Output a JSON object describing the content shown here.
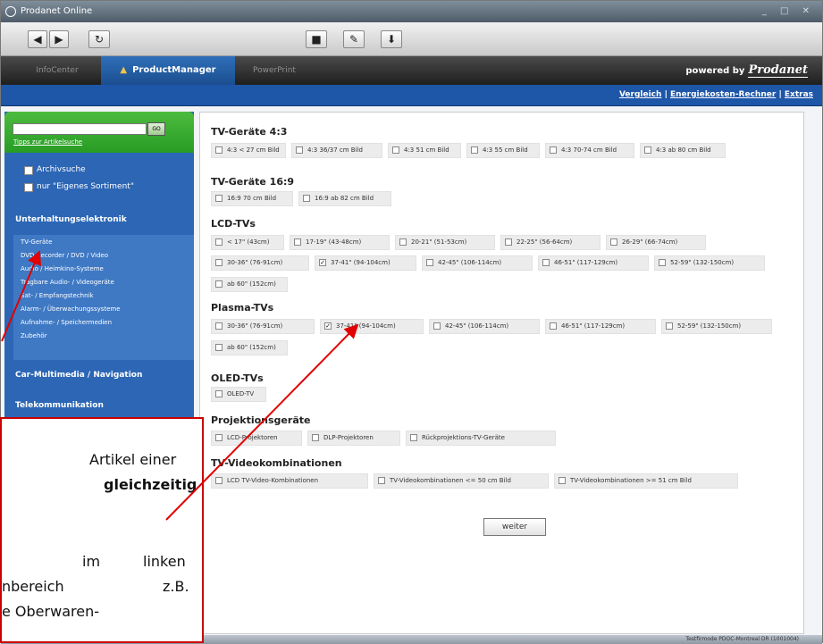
{
  "window": {
    "title": "Prodanet Online"
  },
  "toolbar": {
    "back": "◀",
    "forward": "▶",
    "refresh": "↻",
    "btn1": "■",
    "btn2": "✎",
    "btn3": "⬇"
  },
  "tabs": [
    {
      "label": "InfoCenter",
      "active": false
    },
    {
      "label": "ProductManager",
      "active": true
    },
    {
      "label": "PowerPrint",
      "active": false
    }
  ],
  "header": {
    "powered_by": "powered by",
    "brand": "Prodanet"
  },
  "toplinks": {
    "vergleich": "Vergleich",
    "sep": "|",
    "rechner": "Energiekosten-Rechner",
    "extras": "Extras"
  },
  "sidebar": {
    "search_button": "GO",
    "tipps": "Tipps zur Artikelsuche",
    "checkbox1": "Archivsuche",
    "checkbox2": "nur \"Eigenes Sortiment\"",
    "category1": "Unterhaltungselektronik",
    "subitems": [
      "TV-Geräte",
      "DVD-Recorder / DVD / Video",
      "Audio / Heimkino-Systeme",
      "Tragbare Audio- / Videogeräte",
      "Sat- / Empfangstechnik",
      "Alarm- / Überwachungssysteme",
      "Aufnahme- / Speichermedien",
      "Zubehör"
    ],
    "category2": "Car-Multimedia / Navigation",
    "category3": "Telekommunikation"
  },
  "groups": {
    "g1": {
      "title": "TV-Geräte 4:3",
      "options": [
        "4:3 < 27 cm Bild",
        "4:3 36/37 cm Bild",
        "4:3 51 cm Bild",
        "4:3 55 cm Bild",
        "4:3 70-74 cm Bild",
        "4:3 ab 80 cm Bild"
      ]
    },
    "g2": {
      "title": "TV-Geräte 16:9",
      "options": [
        "16:9 70 cm Bild",
        "16:9 ab 82 cm Bild"
      ]
    },
    "g3": {
      "title": "LCD-TVs",
      "options": [
        "< 17\" (43cm)",
        "17-19\" (43-48cm)",
        "20-21\" (51-53cm)",
        "22-25\" (56-64cm)",
        "26-29\" (66-74cm)",
        "30-36\" (76-91cm)",
        "37-41\" (94-104cm)",
        "42-45\" (106-114cm)",
        "46-51\" (117-129cm)",
        "52-59\" (132-150cm)",
        "ab 60\" (152cm)"
      ]
    },
    "g4": {
      "title": "Plasma-TVs",
      "options": [
        "30-36\" (76-91cm)",
        "37-41\" (94-104cm)",
        "42-45\" (106-114cm)",
        "46-51\" (117-129cm)",
        "52-59\" (132-150cm)",
        "ab 60\" (152cm)"
      ]
    },
    "g5": {
      "title": "OLED-TVs",
      "options": [
        "OLED-TV"
      ]
    },
    "g6": {
      "title": "Projektionsgeräte",
      "options": [
        "LCD-Projektoren",
        "DLP-Projektoren",
        "Rückprojektions-TV-Geräte"
      ]
    },
    "g7": {
      "title": "TV-Videokombinationen",
      "options": [
        "LCD TV-Video-Kombinationen",
        "TV-Videokombinationen <= 50 cm Bild",
        "TV-Videokombinationen >= 51 cm Bild"
      ]
    }
  },
  "checked": {
    "lcd_37_41": true,
    "plasma_37_41": true
  },
  "weiter": "weiter",
  "status": "Testfirmode PDOC-Montreal DR (1001004)",
  "callout": {
    "line1": "Artikel einer",
    "line2": "gleichzeitig",
    "line3a": "im",
    "line3b": "linken",
    "line4a": "nbereich",
    "line4b": "z.B.",
    "line5": "e Oberwaren-"
  },
  "colors": {
    "accent": "#1e56a8",
    "green": "#34a82e",
    "arrow": "#e00000"
  }
}
